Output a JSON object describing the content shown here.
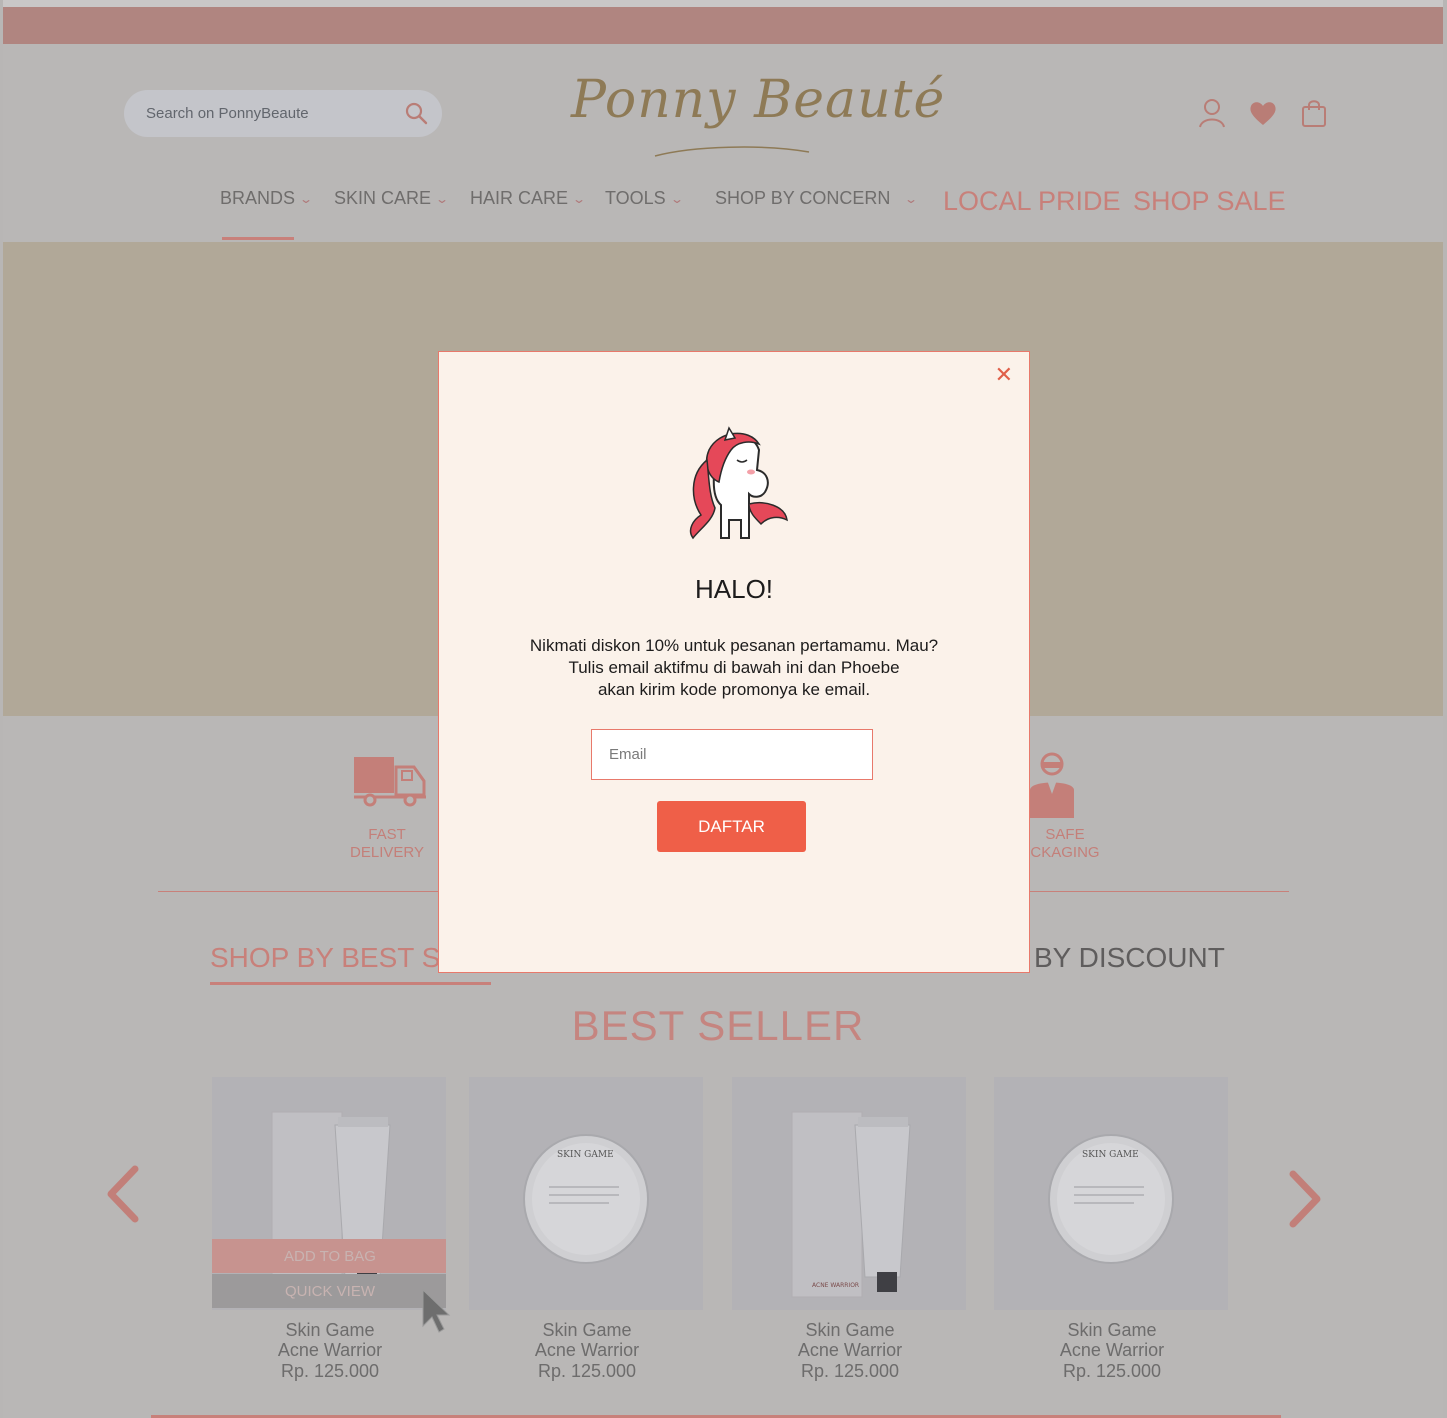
{
  "header": {
    "search": {
      "placeholder": "Search on PonnyBeaute"
    },
    "logo_text": "Ponny Beauté"
  },
  "nav": {
    "items": [
      {
        "label": "BRANDS"
      },
      {
        "label": "SKIN CARE"
      },
      {
        "label": "HAIR CARE"
      },
      {
        "label": "TOOLS"
      },
      {
        "label": "SHOP BY CONCERN"
      }
    ],
    "local_pride": "LOCAL PRIDE",
    "shop_sale": "SHOP SALE"
  },
  "features": [
    {
      "line1": "FAST",
      "line2": "DELIVERY"
    },
    {
      "line1": "SAFE",
      "line2": "CKAGING"
    }
  ],
  "sections": {
    "tab_best": "SHOP BY BEST SELL",
    "tab_discount": "BY DISCOUNT",
    "title": "BEST SELLER"
  },
  "products": [
    {
      "name1": "Skin Game",
      "name2": "Acne Warrior",
      "price": "Rp. 125.000"
    },
    {
      "name1": "Skin Game",
      "name2": "Acne Warrior",
      "price": "Rp. 125.000"
    },
    {
      "name1": "Skin Game",
      "name2": "Acne Warrior",
      "price": "Rp. 125.000"
    },
    {
      "name1": "Skin Game",
      "name2": "Acne Warrior",
      "price": "Rp. 125.000"
    }
  ],
  "card_actions": {
    "add_to_bag": "ADD TO BAG",
    "quick_view": "QUICK VIEW"
  },
  "product_label": {
    "brand": "SKIN GAME",
    "line": "ACNE WARRIOR"
  },
  "modal": {
    "close": "✕",
    "title": "HALO!",
    "body_line1": "Nikmati diskon 10% untuk pesanan pertamamu. Mau?",
    "body_line2": "Tulis email aktifmu di bawah ini dan Phoebe",
    "body_line3": "akan kirim kode promonya ke email.",
    "email_placeholder": "Email",
    "submit": "DAFTAR"
  },
  "colors": {
    "accent": "#ef5f48",
    "brand_pink": "#c8807a",
    "modal_bg": "#fbf2ea",
    "overlay": "#b9b7b6"
  },
  "icons": [
    "search-icon",
    "user-icon",
    "heart-icon",
    "shopping-bag-icon",
    "delivery-truck-icon",
    "courier-icon",
    "close-icon",
    "chevron-left-icon",
    "chevron-right-icon",
    "unicorn-mascot",
    "cursor-icon"
  ]
}
